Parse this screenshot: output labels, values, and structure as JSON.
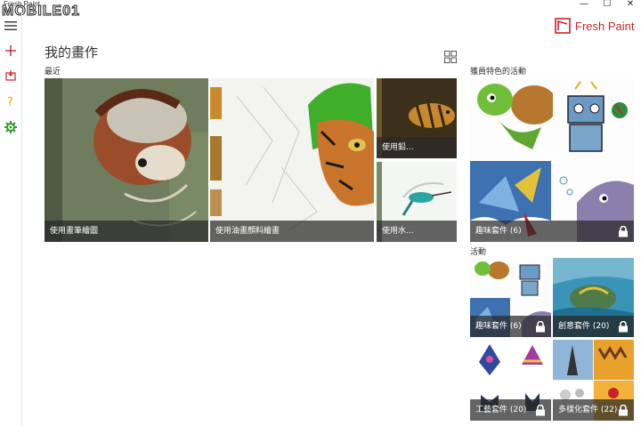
{
  "titlebar": {
    "app_name": "Fresh Paint",
    "watermark": "MOBILE01",
    "minimize": "—",
    "maximize": "☐",
    "close": "✕"
  },
  "brand": {
    "name": "Fresh Paint",
    "color": "#c8232c"
  },
  "page": {
    "title": "我的畫作"
  },
  "recent": {
    "label": "最近",
    "tiles": [
      {
        "caption": "使用畫筆繪圖",
        "subject": "red-panda"
      },
      {
        "caption": "使用油畫顏料繪畫",
        "subject": "tiger"
      },
      {
        "caption": "使用鉛...",
        "subject": "fish"
      },
      {
        "caption": "使用水...",
        "subject": "hummingbird"
      }
    ]
  },
  "featured": {
    "label": "獲員特色的活動",
    "caption": "趣味套件 (6)"
  },
  "activities": {
    "label": "活動",
    "items": [
      {
        "caption": "趣味套件 (6)"
      },
      {
        "caption": "創意套件 (20)"
      },
      {
        "caption": "工藝套件 (20)"
      },
      {
        "caption": "多樣化套件 (22)"
      }
    ]
  },
  "rail_icons": [
    "menu-icon",
    "add-icon",
    "import-icon",
    "help-icon",
    "settings-icon"
  ],
  "colors": {
    "accent": "#c8232c",
    "help": "#e0a800",
    "settings": "#2e9a2e"
  }
}
